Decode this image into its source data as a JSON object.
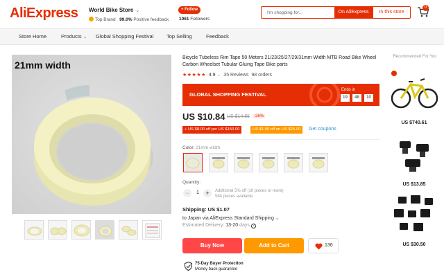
{
  "header": {
    "logo": "AliExpress",
    "store_name": "World Bike Store",
    "top_brand": "Top Brand",
    "positive_pct": "99.0%",
    "positive_label": "Positive feedback",
    "follow_label": "+ Follow",
    "followers_count": "1061",
    "followers_label": "Followers",
    "search_placeholder": "I'm shopping for...",
    "search_btn_ae": "On AliExpress",
    "search_btn_store": "In this store",
    "cart_count": "0"
  },
  "nav": {
    "items": [
      "Store Home",
      "Products",
      "Global Shopping Festival",
      "Top Selling",
      "Feedback"
    ]
  },
  "gallery": {
    "main_label": "21mm width",
    "thumb_count": 6
  },
  "product": {
    "title": "Bicycle Tubeless Rim Tape 50 Meters 21/23/25/27/29/31mm Width MTB Road Bike Wheel Carbon Wheelset Tubular Gluing Tape Bike parts",
    "rating": "4.9",
    "reviews": "35 Reviews",
    "orders": "98 orders",
    "festival_title": "GLOBAL SHOPPING FESTIVAL",
    "ends_in": "Ends in",
    "countdown": [
      "19",
      "48",
      "10"
    ],
    "price": "US $10.84",
    "old_price": "US $14.65",
    "discount": "-26%",
    "coupon1": "+ US $8.00 off per US $150.00",
    "coupon2": "US $1.00 off on US $25.00",
    "get_coupons": "Get coupons",
    "color_label": "Color:",
    "color_value": "21mm width",
    "quantity_label": "Quantity:",
    "quantity": "1",
    "qty_note_1": "Additional 5% off (10 pieces or more)",
    "qty_note_2": "584 pieces available",
    "shipping_label": "Shipping: US $1.07",
    "shipping_to": "to Japan via AliExpress Standard Shipping",
    "delivery_label": "Estimated Delivery:",
    "delivery_days": "13-20",
    "delivery_unit": "days",
    "buy_now": "Buy Now",
    "add_to_cart": "Add to Cart",
    "wishlist_count": "136",
    "protection_title": "75-Day Buyer Protection",
    "protection_sub": "Money back guarantee"
  },
  "recommended": {
    "title": "Recommended For You",
    "items": [
      {
        "price": "US $740.61"
      },
      {
        "price": "US $13.85"
      },
      {
        "price": "US $30.50"
      }
    ]
  },
  "colors": {
    "brand": "#e62e04",
    "buy": "#ff4747",
    "cart": "#ff9900",
    "link": "#2d8fd4"
  }
}
